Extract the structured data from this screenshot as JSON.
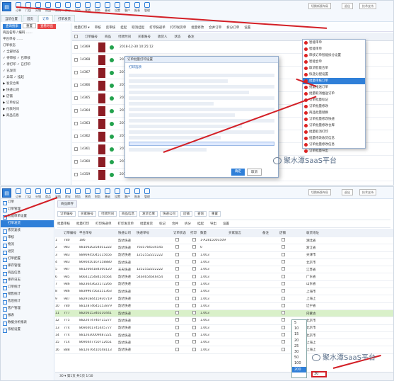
{
  "top_panel": {
    "nav_items": [
      "订单",
      "门店",
      "分销",
      "商品",
      "采购",
      "库存",
      "财务",
      "营销",
      "财务",
      "基础",
      "设置",
      "客户",
      "报表",
      "管理"
    ],
    "topright_btns": [
      "切换新版布局",
      "退出",
      "技术支持"
    ],
    "tabs": [
      "当前位置",
      "首页",
      "订单",
      "打单发货"
    ],
    "sidebar": {
      "filter_btns": [
        "查询搜索",
        "重置",
        "查看导出"
      ],
      "rows": [
        "商品名称 / 编码 ……",
        "平台单号 ……",
        "订单状态",
        "✓ 全部状态",
        "✓ 待审核 ✓ 已审核",
        "✓ 待打印 ✓ 已打印",
        "✓ 已发货",
        "✓ 异常 ✓ 挂起",
        "▶ 发货仓库",
        "▶ 快递公司",
        "▶ 店铺",
        "▶ 订单标记",
        "▶ 付款时间",
        "▶ 商品信息"
      ]
    },
    "toolbar": [
      "批量打印 ▾",
      "审核",
      "反审核",
      "挂起",
      "取消挂起",
      "打印快递单",
      "打印发货单",
      "批量修改",
      "合并订单",
      "拆分订单",
      "设置"
    ],
    "grid_header": [
      "订单编号",
      "商品",
      "付款时间",
      "买家账号",
      "收货人",
      "状态",
      "备注"
    ],
    "rows": [
      {
        "id": "14369",
        "time": "2018-12-30 10:25:12"
      },
      {
        "id": "14368",
        "time": "2018-12-30 10:21:06"
      },
      {
        "id": "14367",
        "time": "2018-12-30 09:58:44"
      },
      {
        "id": "14366",
        "time": "2018-12-30 09:40:31"
      },
      {
        "id": "14365",
        "time": "2018-12-30 09:12:05"
      },
      {
        "id": "14364",
        "time": "2018-12-29 22:47:19"
      },
      {
        "id": "14363",
        "time": "2018-12-29 21:33:52"
      },
      {
        "id": "14362",
        "time": "2018-12-29 20:08:17"
      },
      {
        "id": "14361",
        "time": "2018-12-29 19:41:03"
      },
      {
        "id": "14360",
        "time": "2018-12-29 18:26:58"
      },
      {
        "id": "14359",
        "time": "2018-12-29 17:15:44"
      }
    ],
    "dialog": {
      "title": "订单批量打印设置",
      "section": "打印选项",
      "ok": "确定",
      "cancel": "取消"
    },
    "menu": {
      "items": [
        "智能审单",
        "智能审单",
        "审核订单智能拆分设置",
        "智能合单",
        "取消智能合单",
        "快递分配设置",
        "批量审核订单",
        "批量推送订单",
        "批量取消推送订单",
        "订单批量标记",
        "订单批量修改",
        "商品批量替换",
        "订单批量修改快递",
        "订单批量修改仓库",
        "批量取消打印",
        "批量修改收货信息",
        "订单批量修改信息",
        "订单批量导出"
      ],
      "selected_index": 6
    }
  },
  "bottom_panel": {
    "nav_items": [
      "订单",
      "门店",
      "分销",
      "商品",
      "采购",
      "库存",
      "财务",
      "营销",
      "财务",
      "基础",
      "设置",
      "客户",
      "报表",
      "管理"
    ],
    "topright_btns": [
      "切换新版布局",
      "退出",
      "技术支持"
    ],
    "tab": "商品库存",
    "sidebar": [
      "订单",
      "订单管理",
      "智能审单设置",
      "打单发货",
      "拣货复核",
      "审核",
      "物流",
      "退货",
      "打单配置",
      "库存管理",
      "商品信息",
      "库存日志",
      "订单统计",
      "销售统计",
      "售后统计",
      "客户管理",
      "报表",
      "数据分析报表",
      "系统设置"
    ],
    "sidebar_selected": 3,
    "filter_bar": [
      "订单编号",
      "买家账号",
      "付款时间",
      "商品信息",
      "发货仓库",
      "快递公司",
      "店铺",
      "查询",
      "重置"
    ],
    "toolbar": [
      "批量审核",
      "批量打印",
      "打印快递单",
      "打印发货单",
      "批量发货",
      "标记",
      "合并",
      "拆分",
      "挂起",
      "导出",
      "设置"
    ],
    "grid_header": [
      "",
      "订单编号",
      "平台单号",
      "快递公司",
      "快递单号",
      "订单状态",
      "打印",
      "数量",
      "买家留言",
      "备注",
      "店铺",
      "收货地址"
    ],
    "rows": [
      {
        "n": "1",
        "id": "780",
        "pid": "186",
        "exp": "韵达快递",
        "track": "",
        "num": "1-A2815003509",
        "msg": "",
        "note": "",
        "addr": "湖北省"
      },
      {
        "n": "2",
        "id": "983",
        "pid": "8810620254051222",
        "exp": "韵达快递",
        "track": "7635764534545",
        "num": "0",
        "msg": "",
        "note": "",
        "addr": "浙江省"
      },
      {
        "n": "3",
        "id": "983",
        "pid": "8896945045115656",
        "exp": "韵达快递",
        "track": "1252552222222",
        "num": "1.003",
        "msg": "",
        "note": "",
        "addr": "天津市"
      },
      {
        "n": "4",
        "id": "983",
        "pid": "8690450167558880",
        "exp": "韵达快递",
        "track": "",
        "num": "1.003",
        "msg": "",
        "note": "",
        "addr": "北京市"
      },
      {
        "n": "5",
        "id": "987",
        "pid": "8812664184300120",
        "exp": "天天快递",
        "track": "1252552222222",
        "num": "1.003",
        "msg": "",
        "note": "",
        "addr": "江苏省"
      },
      {
        "n": "6",
        "id": "985",
        "pid": "8664125484556564",
        "exp": "韵达快递",
        "track": "5464654646454",
        "num": "1.003",
        "msg": "",
        "note": "",
        "addr": "广东省"
      },
      {
        "n": "7",
        "id": "986",
        "pid": "8823643622172266",
        "exp": "韵达快递",
        "track": "",
        "num": "1.003",
        "msg": "",
        "note": "",
        "addr": "山东省"
      },
      {
        "n": "8",
        "id": "986",
        "pid": "8839967562251363",
        "exp": "韵达快递",
        "track": "",
        "num": "1.003",
        "msg": "",
        "note": "",
        "addr": "上海市"
      },
      {
        "n": "9",
        "id": "987",
        "pid": "8829184415930719",
        "exp": "韵达快递",
        "track": "",
        "num": "1.003",
        "msg": "",
        "note": "",
        "addr": "上海上"
      },
      {
        "n": "10",
        "id": "780",
        "pid": "8812874645153879",
        "exp": "韵达快递",
        "track": "",
        "num": "1.003",
        "msg": "",
        "note": "",
        "addr": "辽宁省"
      },
      {
        "n": "11",
        "id": "777",
        "pid": "8820615346510441",
        "exp": "韵达快递",
        "track": "",
        "num": "1.003",
        "msg": "",
        "note": "",
        "addr": "内蒙古"
      },
      {
        "n": "12",
        "id": "775",
        "pid": "8822074746715277",
        "exp": "韵达快递",
        "track": "",
        "num": "1.003",
        "msg": "",
        "note": "",
        "addr": "北京市"
      },
      {
        "n": "13",
        "id": "774",
        "pid": "8690401745445777",
        "exp": "韵达快递",
        "track": "",
        "num": "1.003",
        "msg": "",
        "note": "",
        "addr": "北京市"
      },
      {
        "n": "14",
        "id": "774",
        "pid": "8812630009487221",
        "exp": "韵达快递",
        "track": "",
        "num": "1.003",
        "msg": "",
        "note": "",
        "addr": "北京市"
      },
      {
        "n": "15",
        "id": "714",
        "pid": "8690447750712651",
        "exp": "韵达快递",
        "track": "",
        "num": "1.003",
        "msg": "",
        "note": "",
        "addr": "上海上"
      },
      {
        "n": "16",
        "id": "888",
        "pid": "8812676410548113",
        "exp": "韵达快递",
        "track": "",
        "num": "1.003",
        "msg": "",
        "note": "",
        "addr": "上海上"
      }
    ],
    "highlight_index": 10,
    "pager": "30 ▾  第1页 共1页  1/10",
    "pager_options": [
      "5",
      "10",
      "15",
      "20",
      "25",
      "30",
      "50",
      "100",
      "200"
    ],
    "pager_selected": "200",
    "pager_value": "30"
  },
  "watermark": "聚水潭SaaS平台"
}
